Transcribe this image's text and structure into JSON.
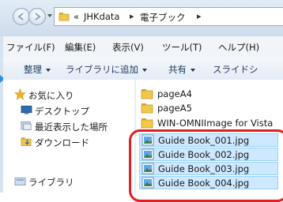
{
  "address": {
    "overflow": "«",
    "segments": [
      "JHKdata",
      "電子ブック"
    ],
    "separator": "▸"
  },
  "menubar": {
    "items": [
      "ファイル(F)",
      "編集(E)",
      "表示(V)",
      "ツール(T)",
      "ヘルプ(H)"
    ]
  },
  "toolbar": {
    "organize": "整理",
    "add_to_library": "ライブラリに追加",
    "share": "共有",
    "slideshow": "スライドシ"
  },
  "navpane": {
    "favorites": "お気に入り",
    "desktop": "デスクトップ",
    "recent": "最近表示した場所",
    "downloads": "ダウンロード",
    "libraries": "ライブラリ"
  },
  "files": [
    {
      "name": "pageA4",
      "type": "folder"
    },
    {
      "name": "pageA5",
      "type": "folder"
    },
    {
      "name": "WIN-OMNIImage for Vista",
      "type": "folder"
    },
    {
      "name": "Guide Book_001.jpg",
      "type": "image"
    },
    {
      "name": "Guide Book_002.jpg",
      "type": "image"
    },
    {
      "name": "Guide Book_003.jpg",
      "type": "image"
    },
    {
      "name": "Guide Book_004.jpg",
      "type": "image"
    }
  ],
  "colors": {
    "highlight_ring": "#e02020",
    "selection": "#cde8ff"
  }
}
